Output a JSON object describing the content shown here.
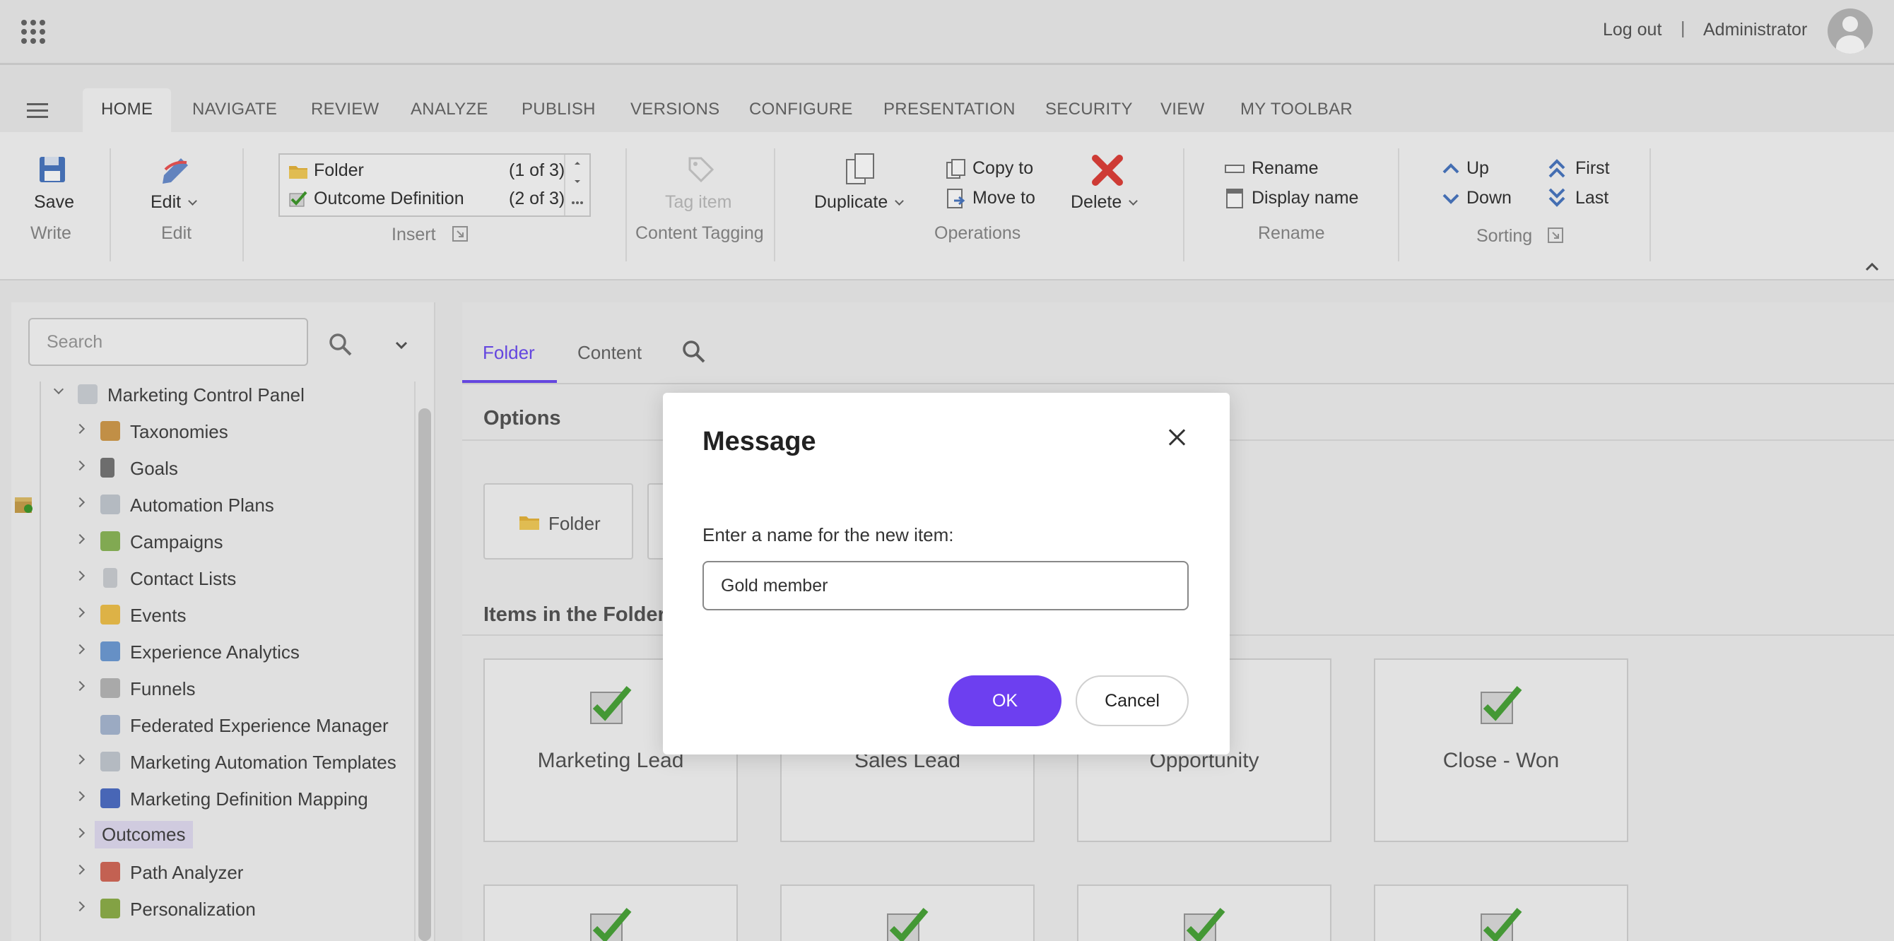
{
  "topbar": {
    "logout": "Log out",
    "separator": "|",
    "user": "Administrator"
  },
  "ribbon_tabs": [
    "HOME",
    "NAVIGATE",
    "REVIEW",
    "ANALYZE",
    "PUBLISH",
    "VERSIONS",
    "CONFIGURE",
    "PRESENTATION",
    "SECURITY",
    "VIEW",
    "MY TOOLBAR"
  ],
  "ribbon": {
    "write": {
      "save": "Save",
      "label": "Write"
    },
    "edit": {
      "edit": "Edit",
      "label": "Edit"
    },
    "insert": {
      "items": [
        {
          "name": "Folder",
          "count": "(1 of 3)"
        },
        {
          "name": "Outcome Definition",
          "count": "(2 of 3)"
        }
      ],
      "label": "Insert"
    },
    "tagging": {
      "tag_item": "Tag item",
      "label": "Content Tagging"
    },
    "operations": {
      "duplicate": "Duplicate",
      "copy_to": "Copy to",
      "move_to": "Move to",
      "delete": "Delete",
      "label": "Operations"
    },
    "rename": {
      "rename": "Rename",
      "display_name": "Display name",
      "label": "Rename"
    },
    "sorting": {
      "up": "Up",
      "down": "Down",
      "first": "First",
      "last": "Last",
      "label": "Sorting"
    }
  },
  "search": {
    "placeholder": "Search"
  },
  "tree": {
    "root": "Marketing Control Panel",
    "items": [
      "Taxonomies",
      "Goals",
      "Automation Plans",
      "Campaigns",
      "Contact Lists",
      "Events",
      "Experience Analytics",
      "Funnels",
      "Federated Experience Manager",
      "Marketing Automation Templates",
      "Marketing Definition Mapping",
      "Outcomes",
      "Path Analyzer",
      "Personalization"
    ],
    "selected": "Outcomes"
  },
  "content": {
    "tabs": [
      "Folder",
      "Content"
    ],
    "options_title": "Options",
    "option_folder": "Folder",
    "items_title": "Items in the Folder",
    "items": [
      "Marketing Lead",
      "Sales Lead",
      "Opportunity",
      "Close - Won"
    ]
  },
  "dialog": {
    "title": "Message",
    "prompt": "Enter a name for the new item:",
    "value": "Gold member",
    "ok": "OK",
    "cancel": "Cancel"
  },
  "colors": {
    "accent": "#6d3ff0",
    "tab_active": "#6d4df2",
    "delete_red": "#e0403a",
    "check_green": "#4aa53a"
  }
}
